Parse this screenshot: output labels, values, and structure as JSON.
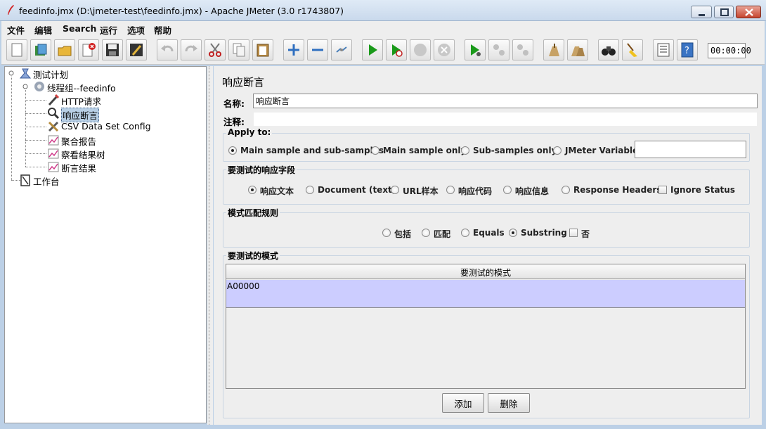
{
  "window": {
    "title": "feedinfo.jmx (D:\\jmeter-test\\feedinfo.jmx) - Apache JMeter (3.0 r1743807)"
  },
  "menu": [
    "文件",
    "编辑",
    "Search",
    "运行",
    "选项",
    "帮助"
  ],
  "toolbar": {
    "timer": "00:00:00",
    "icons": [
      "new-icon",
      "templates-icon",
      "open-icon",
      "close-file-icon",
      "save-icon",
      "save-as-icon",
      "undo-icon",
      "redo-icon",
      "cut-icon",
      "copy-icon",
      "paste-icon",
      "expand-icon",
      "collapse-icon",
      "toggle-icon",
      "start-icon",
      "start-no-pause-icon",
      "stop-icon",
      "shutdown-icon",
      "remote-start-icon",
      "remote-stop-icon",
      "remote-shutdown-icon",
      "clear-icon",
      "clear-all-icon",
      "search-icon",
      "reset-search-icon",
      "function-helper-icon",
      "help-icon"
    ]
  },
  "tree": {
    "items": [
      {
        "label": "测试计划",
        "icon": "test-plan-icon"
      },
      {
        "label": "线程组--feedinfo",
        "icon": "thread-group-icon"
      },
      {
        "label": "HTTP请求",
        "icon": "http-sampler-icon"
      },
      {
        "label": "响应断言",
        "icon": "assertion-icon",
        "selected": true
      },
      {
        "label": "CSV Data Set Config",
        "icon": "config-icon"
      },
      {
        "label": "聚合报告",
        "icon": "listener-icon"
      },
      {
        "label": "察看结果树",
        "icon": "listener-icon"
      },
      {
        "label": "断言结果",
        "icon": "listener-icon"
      },
      {
        "label": "工作台",
        "icon": "workbench-icon"
      }
    ]
  },
  "panel": {
    "heading": "响应断言",
    "name_label": "名称:",
    "name_value": "响应断言",
    "comment_label": "注释:",
    "comment_value": "",
    "apply_to": {
      "title": "Apply to:",
      "options": [
        "Main sample and sub-samples",
        "Main sample only",
        "Sub-samples only",
        "JMeter Variable"
      ],
      "selected": "Main sample and sub-samples",
      "variable_value": ""
    },
    "response_field": {
      "title": "要测试的响应字段",
      "options": [
        "响应文本",
        "Document (text)",
        "URL样本",
        "响应代码",
        "响应信息",
        "Response Headers"
      ],
      "selected": "响应文本",
      "ignore_status_label": "Ignore Status",
      "ignore_status_checked": false
    },
    "pattern_rules": {
      "title": "模式匹配规则",
      "options": [
        "包括",
        "匹配",
        "Equals",
        "Substring"
      ],
      "selected": "Substring",
      "not_label": "否",
      "not_checked": false
    },
    "patterns": {
      "title": "要测试的模式",
      "column_header": "要测试的模式",
      "rows": [
        "A00000"
      ]
    },
    "buttons": {
      "add": "添加",
      "delete": "删除"
    }
  },
  "colors": {
    "selected_row": "#cccdff",
    "panel_bg": "#eeeeee",
    "run_green": "#1a9a1a"
  }
}
